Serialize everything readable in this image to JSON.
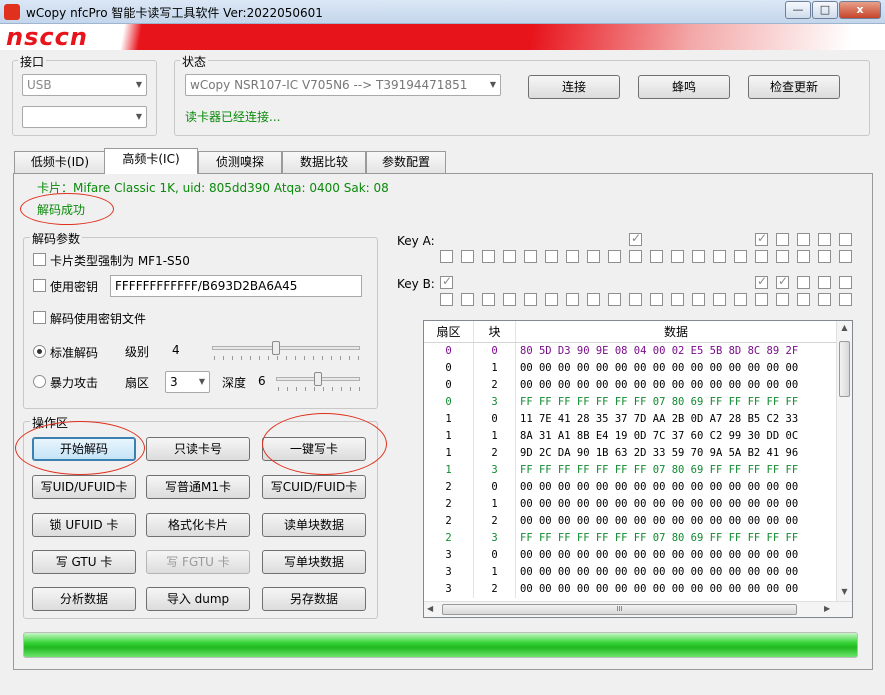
{
  "window": {
    "title": "wCopy nfcPro 智能卡读写工具软件  Ver:2022050601",
    "min_label": "—",
    "max_label": "□",
    "close_label": "x"
  },
  "brand": {
    "logo_text": "nsccn",
    "accent": "#e8141c"
  },
  "port_group": {
    "label": "接口",
    "port_value": "USB",
    "second_value": ""
  },
  "status_group": {
    "label": "状态",
    "device_value": "wCopy NSR107-IC V705N6 --> T39194471851",
    "status_text": "读卡器已经连接...",
    "connect_label": "连接",
    "beep_label": "蜂鸣",
    "update_label": "检查更新"
  },
  "tabs": [
    {
      "label": "低频卡(ID)"
    },
    {
      "label": "高频卡(IC)"
    },
    {
      "label": "侦测嗅探"
    },
    {
      "label": "数据比较"
    },
    {
      "label": "参数配置"
    }
  ],
  "card_info": "卡片：Mifare Classic 1K, uid: 805dd390   Atqa: 0400   Sak: 08",
  "decode_status": "解码成功",
  "decode_params": {
    "label": "解码参数",
    "force_type_label": "卡片类型强制为 MF1-S50",
    "use_key_label": "使用密钥",
    "key_value": "FFFFFFFFFFFF/B693D2BA6A45",
    "use_key_file_label": "解码使用密钥文件",
    "standard_label": "标准解码",
    "level_label": "级别",
    "level_value": "4",
    "brute_label": "暴力攻击",
    "sector_label": "扇区",
    "sector_value": "3",
    "depth_label": "深度",
    "depth_value": "6"
  },
  "operations": {
    "label": "操作区",
    "buttons": [
      "开始解码",
      "只读卡号",
      "一键写卡",
      "写UID/UFUID卡",
      "写普通M1卡",
      "写CUID/FUID卡",
      "锁 UFUID 卡",
      "格式化卡片",
      "读单块数据",
      "写 GTU 卡",
      "写 FGTU 卡",
      "写单块数据",
      "分析数据",
      "导入 dump",
      "另存数据"
    ]
  },
  "keys": {
    "key_a_label": "Key A:",
    "key_b_label": "Key B:",
    "key_a_top_checked": [
      false,
      false,
      false,
      false,
      false,
      false,
      false,
      false,
      false,
      true,
      false,
      false,
      false,
      false,
      false,
      true,
      false,
      false,
      false,
      false
    ],
    "key_b_top_checked": [
      true,
      false,
      false,
      false,
      false,
      false,
      false,
      false,
      false,
      false,
      false,
      false,
      false,
      false,
      false,
      true,
      true,
      false,
      false,
      false
    ]
  },
  "table": {
    "headers": [
      "扇区",
      "块",
      "数据"
    ],
    "rows": [
      [
        "0",
        "0",
        "80 5D D3 90 9E 08 04 00 02 E5 5B 8D 8C 89 2F",
        "purple"
      ],
      [
        "0",
        "1",
        "00 00 00 00 00 00 00 00 00 00 00 00 00 00 00",
        ""
      ],
      [
        "0",
        "2",
        "00 00 00 00 00 00 00 00 00 00 00 00 00 00 00",
        ""
      ],
      [
        "0",
        "3",
        "FF FF FF FF FF FF FF 07 80 69 FF FF FF FF FF",
        "green"
      ],
      [
        "1",
        "0",
        "11 7E 41 28 35 37 7D AA 2B 0D A7 28 B5 C2 33",
        ""
      ],
      [
        "1",
        "1",
        "8A 31 A1 8B E4 19 0D 7C 37 60 C2 99 30 DD 0C",
        ""
      ],
      [
        "1",
        "2",
        "9D 2C DA 90 1B 63 2D 33 59 70 9A 5A B2 41 96",
        ""
      ],
      [
        "1",
        "3",
        "FF FF FF FF FF FF FF 07 80 69 FF FF FF FF FF",
        "green"
      ],
      [
        "2",
        "0",
        "00 00 00 00 00 00 00 00 00 00 00 00 00 00 00",
        ""
      ],
      [
        "2",
        "1",
        "00 00 00 00 00 00 00 00 00 00 00 00 00 00 00",
        ""
      ],
      [
        "2",
        "2",
        "00 00 00 00 00 00 00 00 00 00 00 00 00 00 00",
        ""
      ],
      [
        "2",
        "3",
        "FF FF FF FF FF FF FF 07 80 69 FF FF FF FF FF",
        "green"
      ],
      [
        "3",
        "0",
        "00 00 00 00 00 00 00 00 00 00 00 00 00 00 00",
        ""
      ],
      [
        "3",
        "1",
        "00 00 00 00 00 00 00 00 00 00 00 00 00 00 00",
        ""
      ],
      [
        "3",
        "2",
        "00 00 00 00 00 00 00 00 00 00 00 00 00 00 00",
        ""
      ]
    ],
    "hscroll_grip": "III"
  },
  "progress": {
    "fraction": 1.0,
    "color": "#22c022"
  }
}
